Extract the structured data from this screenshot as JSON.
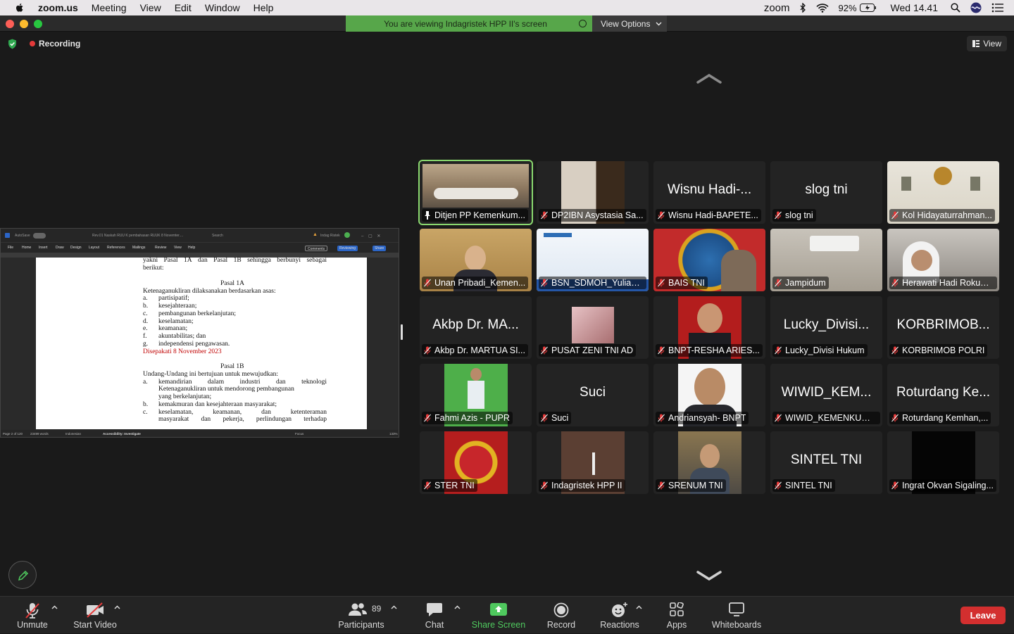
{
  "menubar": {
    "app": "zoom.us",
    "items": [
      "Meeting",
      "View",
      "Edit",
      "Window",
      "Help"
    ],
    "zoom_label": "zoom",
    "battery": "92%",
    "clock": "Wed 14.41"
  },
  "titlebar": {
    "viewing_text": "You are viewing Indagristek HPP II's screen",
    "view_options": "View Options"
  },
  "meeting": {
    "recording": "Recording",
    "view_label": "View"
  },
  "shared_doc": {
    "filename": "Rev.01 Naskah RUU K pembahasan RUUK 8 Novemter....",
    "search": "Search",
    "user": "Indag Ristek",
    "autosave": "AutoSave",
    "menu": [
      "File",
      "Home",
      "Insert",
      "Draw",
      "Design",
      "Layout",
      "References",
      "Mailings",
      "Review",
      "View",
      "Help"
    ],
    "comments": "Comments",
    "reviewing": "Reviewing",
    "share": "Share",
    "status_page": "Page 2 of 120",
    "status_words": "23499 words",
    "status_lang": "Indonesian",
    "status_access": "Accessibility: Investigate",
    "status_focus": "Focus",
    "status_zoom": "133%",
    "lines": {
      "l1": [
        "yakni",
        "Pasal",
        "1A",
        "dan",
        "Pasal",
        "1B",
        "sehingga",
        "berbunyi",
        "sebagai"
      ],
      "l2": "berikut:",
      "pasal1a": "Pasal 1A",
      "l3": "Ketenaganukliran dilaksanakan berdasarkan asas:",
      "a1": "a.",
      "a1t": "partisipatif;",
      "b1": "b.",
      "b1t": "kesejahteraan;",
      "c1": "c.",
      "c1t": "pembangunan berkelanjutan;",
      "d1": "d.",
      "d1t": "keselamatan;",
      "e1": "e.",
      "e1t": "keamanan;",
      "f1": "f.",
      "f1t": "akuntabilitas; dan",
      "g1": "g.",
      "g1t": "independensi pengawasan.",
      "agreed": "Disepakati 8 November 2023",
      "pasal1b": "Pasal 1B",
      "l4": "Undang-Undang ini bertujuan untuk mewujudkan:",
      "a2": "a.",
      "a2t": [
        "kemandirian",
        "dalam",
        "industri",
        "dan",
        "teknologi"
      ],
      "a2t2": "Ketenaganukliran untuk mendorong pembangunan",
      "a2t3": "yang berkelanjutan;",
      "b2": "b.",
      "b2t": "kemakmuran dan kesejahteraan masyarakat;",
      "c2": "c.",
      "c2t": [
        "keselamatan,",
        "keamanan,",
        "dan",
        "ketenteraman"
      ],
      "c2t2": [
        "masyarakat",
        "dan",
        "pekerja,",
        "perlindungan",
        "terhadap"
      ]
    }
  },
  "participants": [
    {
      "big": "",
      "name": "Ditjen PP Kemenkum...",
      "pinned": true
    },
    {
      "big": "",
      "name": "DP2IBN Asystasia Sa..."
    },
    {
      "big": "Wisnu Hadi-...",
      "name": "Wisnu Hadi-BAPETE..."
    },
    {
      "big": "slog tni",
      "name": "slog tni"
    },
    {
      "big": "",
      "name": "Kol Hidayaturrahman..."
    },
    {
      "big": "",
      "name": "Unan Pribadi_Kemen..."
    },
    {
      "big": "",
      "name": "BSN_SDMOH_Yuliand..."
    },
    {
      "big": "",
      "name": "BAIS TNI"
    },
    {
      "big": "",
      "name": "Jampidum"
    },
    {
      "big": "",
      "name": "Herawati Hadi Rokum..."
    },
    {
      "big": "Akbp Dr. MA...",
      "name": "Akbp Dr. MARTUA SI..."
    },
    {
      "big": "",
      "name": "PUSAT ZENI TNI AD"
    },
    {
      "big": "",
      "name": "BNPT-RESHA ARIES..."
    },
    {
      "big": "Lucky_Divisi...",
      "name": "Lucky_Divisi Hukum"
    },
    {
      "big": "KORBRIMOB...",
      "name": "KORBRIMOB POLRI"
    },
    {
      "big": "",
      "name": "Fahmi Azis - PUPR"
    },
    {
      "big": "Suci",
      "name": "Suci"
    },
    {
      "big": "",
      "name": "Andriansyah- BNPT"
    },
    {
      "big": "WIWID_KEM...",
      "name": "WIWID_KEMENKUMH..."
    },
    {
      "big": "Roturdang Ke...",
      "name": "Roturdang Kemhan,..."
    },
    {
      "big": "",
      "name": "STER TNI"
    },
    {
      "big": "",
      "name": "Indagristek HPP II"
    },
    {
      "big": "",
      "name": "SRENUM TNI"
    },
    {
      "big": "SINTEL TNI",
      "name": "SINTEL TNI"
    },
    {
      "big": "",
      "name": "Ingrat Okvan Sigaling..."
    }
  ],
  "toolbar": {
    "unmute": "Unmute",
    "start_video": "Start Video",
    "participants": "Participants",
    "participants_count": "89",
    "chat": "Chat",
    "share_screen": "Share Screen",
    "record": "Record",
    "reactions": "Reactions",
    "apps": "Apps",
    "whiteboards": "Whiteboards",
    "leave": "Leave"
  },
  "colors": {
    "accent_green": "#4fc95e",
    "banner_green": "#57a64a",
    "leave_red": "#d32f2f",
    "active_speaker": "#8ad86f"
  }
}
